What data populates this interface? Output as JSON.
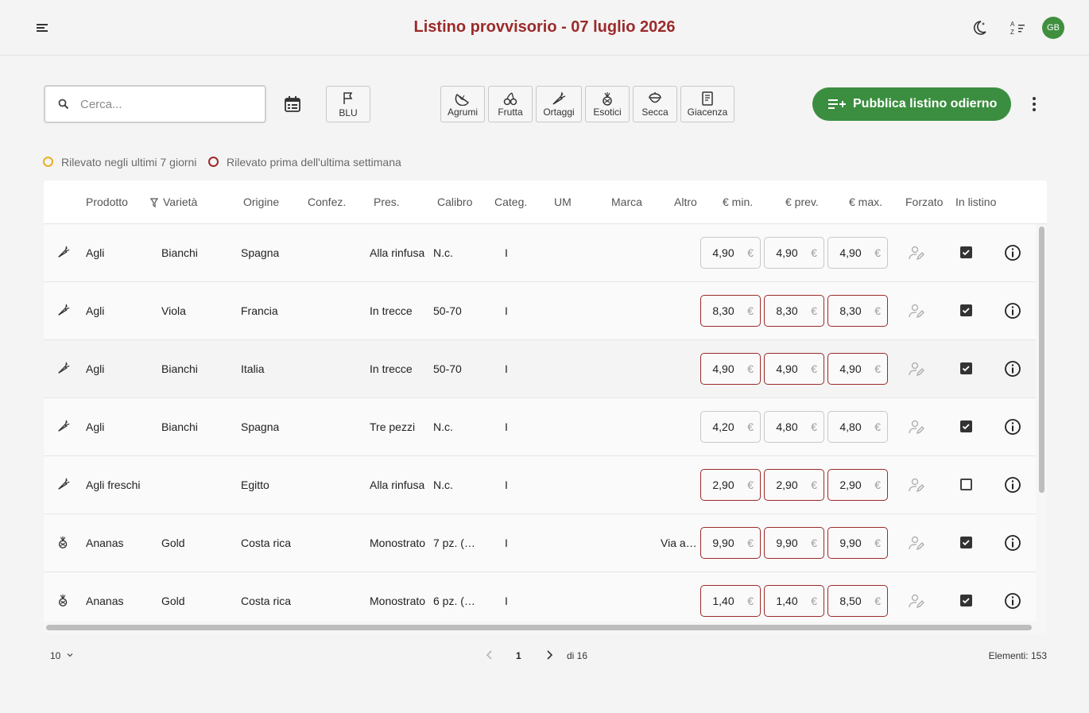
{
  "header": {
    "title": "Listino provvisorio - 07 luglio 2026",
    "avatar_initials": "GB",
    "icons": [
      "menu-icon",
      "dark-mode-icon",
      "sort-alpha-icon"
    ]
  },
  "toolbar": {
    "search_placeholder": "Cerca...",
    "blu_label": "BLU",
    "categories": [
      {
        "label": "Agrumi",
        "icon": "citrus-icon"
      },
      {
        "label": "Frutta",
        "icon": "cherry-icon"
      },
      {
        "label": "Ortaggi",
        "icon": "carrot-icon"
      },
      {
        "label": "Esotici",
        "icon": "pineapple-icon"
      },
      {
        "label": "Secca",
        "icon": "nut-icon"
      },
      {
        "label": "Giacenza",
        "icon": "stock-icon"
      }
    ],
    "publish_label": "Pubblica listino odierno"
  },
  "legend": {
    "recent": "Rilevato negli ultimi 7 giorni",
    "old": "Rilevato prima dell'ultima settimana",
    "recent_color": "#e8b023",
    "old_color": "#9c2a2a"
  },
  "table": {
    "columns": {
      "prodotto": "Prodotto",
      "varieta": "Varietà",
      "origine": "Origine",
      "confez": "Confez.",
      "pres": "Pres.",
      "calibro": "Calibro",
      "categ": "Categ.",
      "um": "UM",
      "marca": "Marca",
      "altro": "Altro",
      "min": "€ min.",
      "prev": "€ prev.",
      "max": "€ max.",
      "forzato": "Forzato",
      "in_listino": "In listino"
    },
    "currency_symbol": "€",
    "rows": [
      {
        "icon": "carrot-icon",
        "prodotto": "Agli",
        "varieta": "Bianchi",
        "origine": "Spagna",
        "confez": "",
        "pres": "Alla rinfusa",
        "calibro": "N.c.",
        "categ": "I",
        "um": "",
        "marca": "",
        "altro": "",
        "min": "4,90",
        "prev": "4,90",
        "max": "4,90",
        "status": "none",
        "in_listino": true
      },
      {
        "icon": "carrot-icon",
        "prodotto": "Agli",
        "varieta": "Viola",
        "origine": "Francia",
        "confez": "",
        "pres": "In trecce",
        "calibro": "50-70",
        "categ": "I",
        "um": "",
        "marca": "",
        "altro": "",
        "min": "8,30",
        "prev": "8,30",
        "max": "8,30",
        "status": "old",
        "in_listino": true
      },
      {
        "icon": "carrot-icon",
        "prodotto": "Agli",
        "varieta": "Bianchi",
        "origine": "Italia",
        "confez": "",
        "pres": "In trecce",
        "calibro": "50-70",
        "categ": "I",
        "um": "",
        "marca": "",
        "altro": "",
        "min": "4,90",
        "prev": "4,90",
        "max": "4,90",
        "status": "old",
        "in_listino": true
      },
      {
        "icon": "carrot-icon",
        "prodotto": "Agli",
        "varieta": "Bianchi",
        "origine": "Spagna",
        "confez": "",
        "pres": "Tre pezzi",
        "calibro": "N.c.",
        "categ": "I",
        "um": "",
        "marca": "",
        "altro": "",
        "min": "4,20",
        "prev": "4,80",
        "max": "4,80",
        "status": "none",
        "in_listino": true
      },
      {
        "icon": "carrot-icon",
        "prodotto": "Agli freschi",
        "varieta": "",
        "origine": "Egitto",
        "confez": "",
        "pres": "Alla rinfusa",
        "calibro": "N.c.",
        "categ": "I",
        "um": "",
        "marca": "",
        "altro": "",
        "min": "2,90",
        "prev": "2,90",
        "max": "2,90",
        "status": "old",
        "in_listino": false
      },
      {
        "icon": "pineapple-icon",
        "prodotto": "Ananas",
        "varieta": "Gold",
        "origine": "Costa rica",
        "confez": "",
        "pres": "Monostrato",
        "calibro": "7 pz. (…",
        "categ": "I",
        "um": "",
        "marca": "",
        "altro": "Via a…",
        "min": "9,90",
        "prev": "9,90",
        "max": "9,90",
        "status": "old",
        "in_listino": true
      },
      {
        "icon": "pineapple-icon",
        "prodotto": "Ananas",
        "varieta": "Gold",
        "origine": "Costa rica",
        "confez": "",
        "pres": "Monostrato",
        "calibro": "6 pz. (…",
        "categ": "I",
        "um": "",
        "marca": "",
        "altro": "",
        "min": "1,40",
        "prev": "1,40",
        "max": "8,50",
        "status": "old",
        "in_listino": true
      }
    ]
  },
  "pagination": {
    "page_size": "10",
    "current_page": "1",
    "of_pages": "di 16",
    "total_label": "Elementi: 153"
  }
}
